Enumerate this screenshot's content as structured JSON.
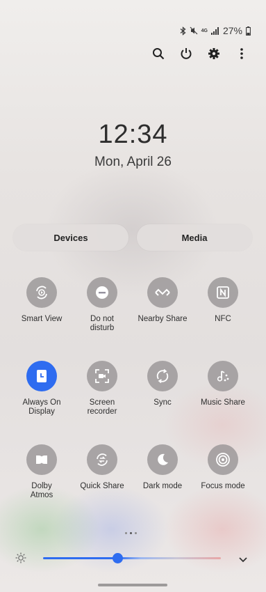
{
  "status": {
    "battery": "27%",
    "network": "4G"
  },
  "top_actions": [
    "search-icon",
    "power-icon",
    "settings-icon",
    "more-icon"
  ],
  "lock": {
    "time": "12:34",
    "date": "Mon, April 26"
  },
  "tabs": {
    "devices": "Devices",
    "media": "Media"
  },
  "tiles": [
    {
      "id": "smart-view",
      "label": "Smart View",
      "icon": "smart-view-icon",
      "on": false
    },
    {
      "id": "do-not-disturb",
      "label": "Do not\ndisturb",
      "icon": "minus-circle-icon",
      "on": false
    },
    {
      "id": "nearby-share",
      "label": "Nearby Share",
      "icon": "nearby-share-icon",
      "on": false
    },
    {
      "id": "nfc",
      "label": "NFC",
      "icon": "nfc-icon",
      "on": false
    },
    {
      "id": "always-on-display",
      "label": "Always On\nDisplay",
      "icon": "clock-icon",
      "on": true
    },
    {
      "id": "screen-recorder",
      "label": "Screen\nrecorder",
      "icon": "screen-recorder-icon",
      "on": false
    },
    {
      "id": "sync",
      "label": "Sync",
      "icon": "sync-icon",
      "on": false
    },
    {
      "id": "music-share",
      "label": "Music Share",
      "icon": "music-share-icon",
      "on": false
    },
    {
      "id": "dolby-atmos",
      "label": "Dolby\nAtmos",
      "icon": "dolby-icon",
      "on": false
    },
    {
      "id": "quick-share",
      "label": "Quick Share",
      "icon": "quick-share-icon",
      "on": false
    },
    {
      "id": "dark-mode",
      "label": "Dark mode",
      "icon": "moon-icon",
      "on": false
    },
    {
      "id": "focus-mode",
      "label": "Focus mode",
      "icon": "focus-icon",
      "on": false
    }
  ],
  "brightness": {
    "level": 0.42
  },
  "page_indicator": {
    "pages": 3,
    "current": 2
  },
  "colors": {
    "accent": "#2e6cf0",
    "tile_off": "#96929e"
  }
}
